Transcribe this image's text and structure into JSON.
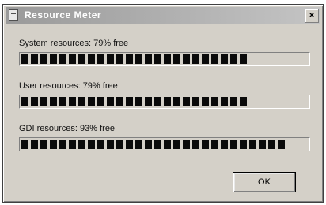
{
  "window": {
    "title": "Resource Meter",
    "close_label": "×"
  },
  "resources": [
    {
      "label": "System resources: 79% free",
      "percent_free": 79
    },
    {
      "label": "User resources: 79% free",
      "percent_free": 79
    },
    {
      "label": "GDI resources: 93% free",
      "percent_free": 93
    }
  ],
  "buttons": {
    "ok_label": "OK"
  }
}
